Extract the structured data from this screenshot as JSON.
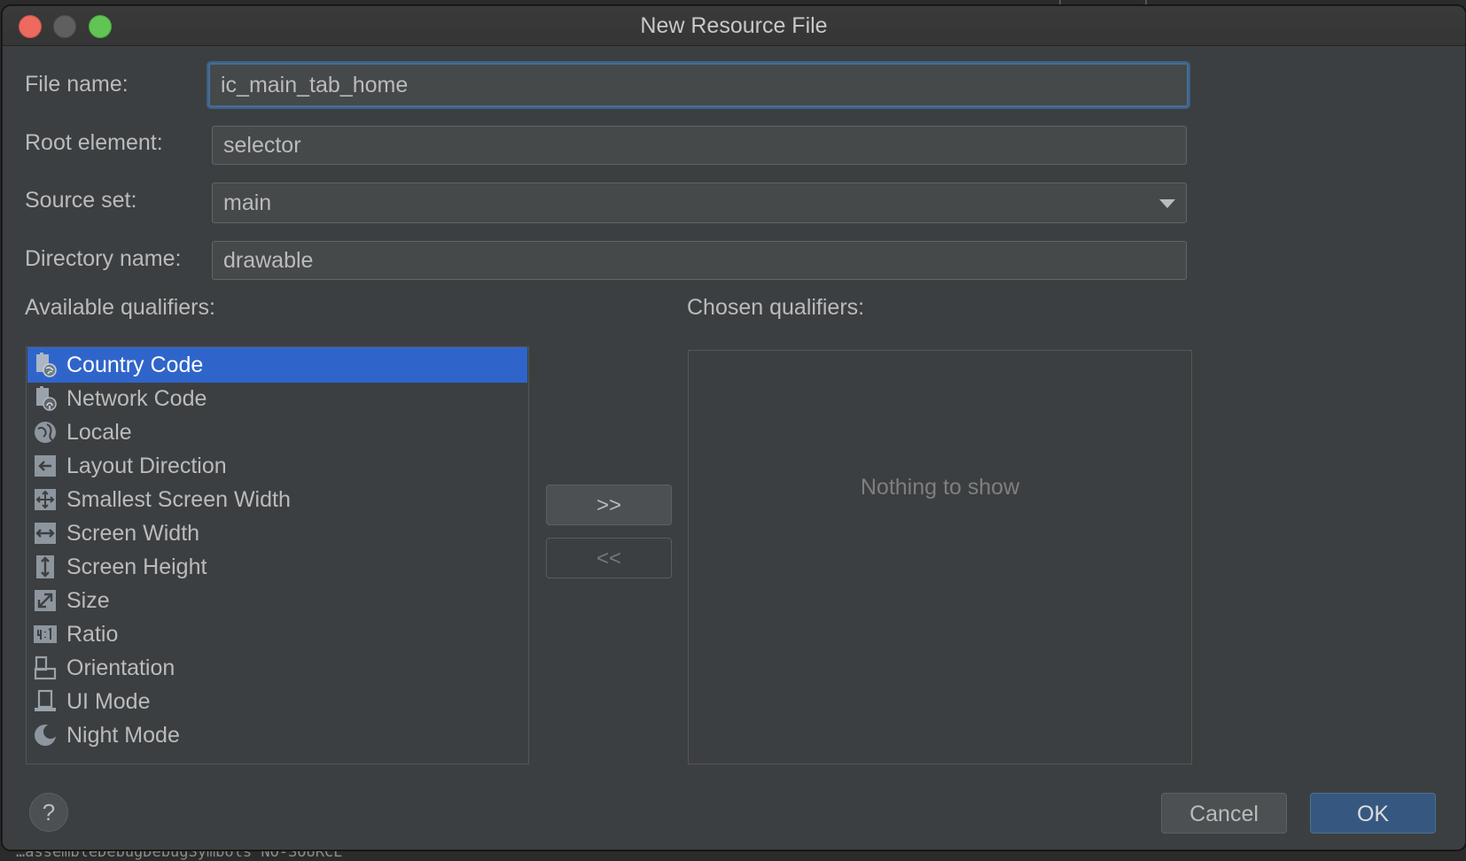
{
  "window": {
    "title": "New Resource File"
  },
  "form": {
    "file_name_label": "File name:",
    "file_name_value": "ic_main_tab_home",
    "root_element_label": "Root element:",
    "root_element_value": "selector",
    "source_set_label": "Source set:",
    "source_set_value": "main",
    "directory_name_label": "Directory name:",
    "directory_name_value": "drawable"
  },
  "qualifiers": {
    "available_label": "Available qualifiers:",
    "chosen_label": "Chosen qualifiers:",
    "chosen_empty_text": "Nothing to show",
    "add_button": ">>",
    "remove_button": "<<",
    "available": [
      {
        "label": "Country Code",
        "icon": "country-code-icon",
        "selected": true
      },
      {
        "label": "Network Code",
        "icon": "network-code-icon",
        "selected": false
      },
      {
        "label": "Locale",
        "icon": "globe-icon",
        "selected": false
      },
      {
        "label": "Layout Direction",
        "icon": "layout-direction-icon",
        "selected": false
      },
      {
        "label": "Smallest Screen Width",
        "icon": "smallest-screen-width-icon",
        "selected": false
      },
      {
        "label": "Screen Width",
        "icon": "screen-width-icon",
        "selected": false
      },
      {
        "label": "Screen Height",
        "icon": "screen-height-icon",
        "selected": false
      },
      {
        "label": "Size",
        "icon": "size-icon",
        "selected": false
      },
      {
        "label": "Ratio",
        "icon": "ratio-icon",
        "selected": false
      },
      {
        "label": "Orientation",
        "icon": "orientation-icon",
        "selected": false
      },
      {
        "label": "UI Mode",
        "icon": "ui-mode-icon",
        "selected": false
      },
      {
        "label": "Night Mode",
        "icon": "night-mode-icon",
        "selected": false
      }
    ]
  },
  "footer": {
    "help_label": "?",
    "cancel_label": "Cancel",
    "ok_label": "OK"
  },
  "backdrop": {
    "console_text": "…assembleDebugDebugSymbols NO-SOURCE"
  },
  "colors": {
    "dialog_bg": "#3c3f41",
    "selection": "#2f65ca",
    "focus_border": "#466d94",
    "ok_button": "#365880"
  }
}
